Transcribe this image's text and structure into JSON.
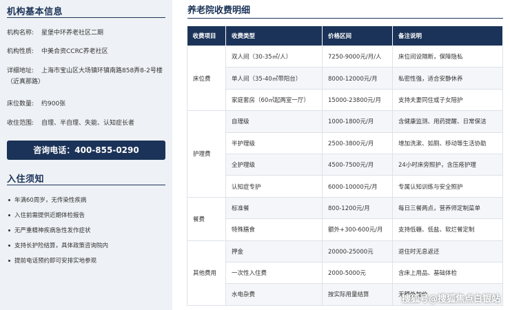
{
  "sidebar": {
    "info_title": "机构基本信息",
    "info": [
      {
        "label": "机构名称:",
        "value": "星堡中环养老社区二期"
      },
      {
        "label": "机构性质:",
        "value": "中美合资CCRC养老社区"
      },
      {
        "label": "详细地址:",
        "value": "上海市宝山区大场镇环镇南路858弄8-2号楼（近真那路）"
      },
      {
        "label": "床位数量:",
        "value": "约900张"
      },
      {
        "label": "收住范围:",
        "value": "自理、半自理、失能、认知症长者"
      }
    ],
    "hotline": "咨询电话：400-855-0290",
    "notice_title": "入住须知",
    "notices": [
      "年满60周岁，无传染性疾病",
      "入住前需提供近期体检报告",
      "无严重精神疾病急性发作症状",
      "支持长护险结算，具体政策咨询院内",
      "提前电话预约即可安排实地参观"
    ]
  },
  "main": {
    "title": "养老院收费明细",
    "headers": [
      "收费项目",
      "收费类型",
      "价格区间",
      "备注说明"
    ],
    "groups": [
      {
        "category": "床位费",
        "rows": [
          [
            "双人间（30-35㎡/人）",
            "7250-9000元/月/人",
            "床位间设隔断，保障隐私"
          ],
          [
            "单人间（35-40㎡带阳台）",
            "8000-12000元/月",
            "私密性强，适合安静休养"
          ],
          [
            "家庭套房（60㎡起两室一厅）",
            "15000-23800元/月",
            "支持夫妻同住或子女陪护"
          ]
        ]
      },
      {
        "category": "护理费",
        "rows": [
          [
            "自理级",
            "1000-1800元/月",
            "含健康监测、用药提醒、日常保洁"
          ],
          [
            "半护理级",
            "2500-3800元/月",
            "增加洗漱、如厕、移动等生活协助"
          ],
          [
            "全护理级",
            "4500-7500元/月",
            "24小时床旁照护，含压疮护理"
          ],
          [
            "认知症专护",
            "6000-10000元/月",
            "专属认知训练与安全照护"
          ]
        ]
      },
      {
        "category": "餐费",
        "rows": [
          [
            "标准餐",
            "800-1200元/月",
            "每日三餐两点，营养师定制菜单"
          ],
          [
            "特殊膳食",
            "额外+300-600元/月",
            "支持低糖、低盐、软烂餐定制"
          ]
        ]
      },
      {
        "category": "其他费用",
        "rows": [
          [
            "押金",
            "20000-25000元",
            "退住时无息返还"
          ],
          [
            "一次性入住费",
            "2000-5000元",
            "含床上用品、基础体检"
          ],
          [
            "水电杂费",
            "按实际用量结算",
            "无额外加价"
          ]
        ]
      }
    ]
  },
  "watermark": "搜狐号@搜狐焦点白银站"
}
